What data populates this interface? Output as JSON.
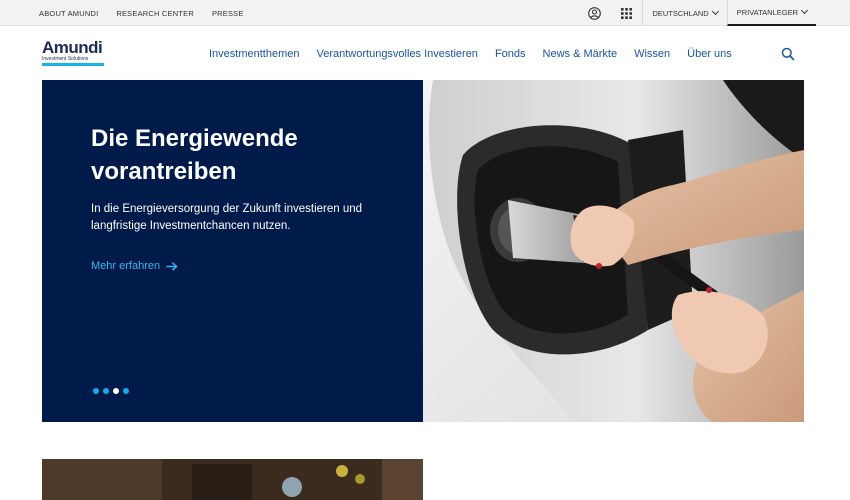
{
  "utility_bar": {
    "links": [
      "ABOUT AMUNDI",
      "RESEARCH CENTER",
      "PRESSE"
    ],
    "country_select": "DEUTSCHLAND",
    "audience_select": "PRIVATANLEGER"
  },
  "header": {
    "logo_word": "Amundi",
    "logo_sub": "Investment Solutions",
    "nav": [
      "Investmentthemen",
      "Verantwortungsvolles Investieren",
      "Fonds",
      "News & Märkte",
      "Wissen",
      "Über uns"
    ]
  },
  "hero": {
    "title": "Die Energiewende vorantreiben",
    "description": "In die Energieversorgung der Zukunft investieren und langfristige Investmentchancen nutzen.",
    "cta": "Mehr erfahren",
    "active_slide": 3,
    "slides_total": 4
  },
  "colors": {
    "brand_navy": "#001b4a",
    "link_blue": "#1a55a0",
    "cta_cyan": "#35b6f0",
    "logo_accent": "#19b4e6"
  },
  "icons": [
    "user-account-icon",
    "apps-grid-icon",
    "chevron-down-icon",
    "search-icon",
    "arrow-right-icon"
  ]
}
